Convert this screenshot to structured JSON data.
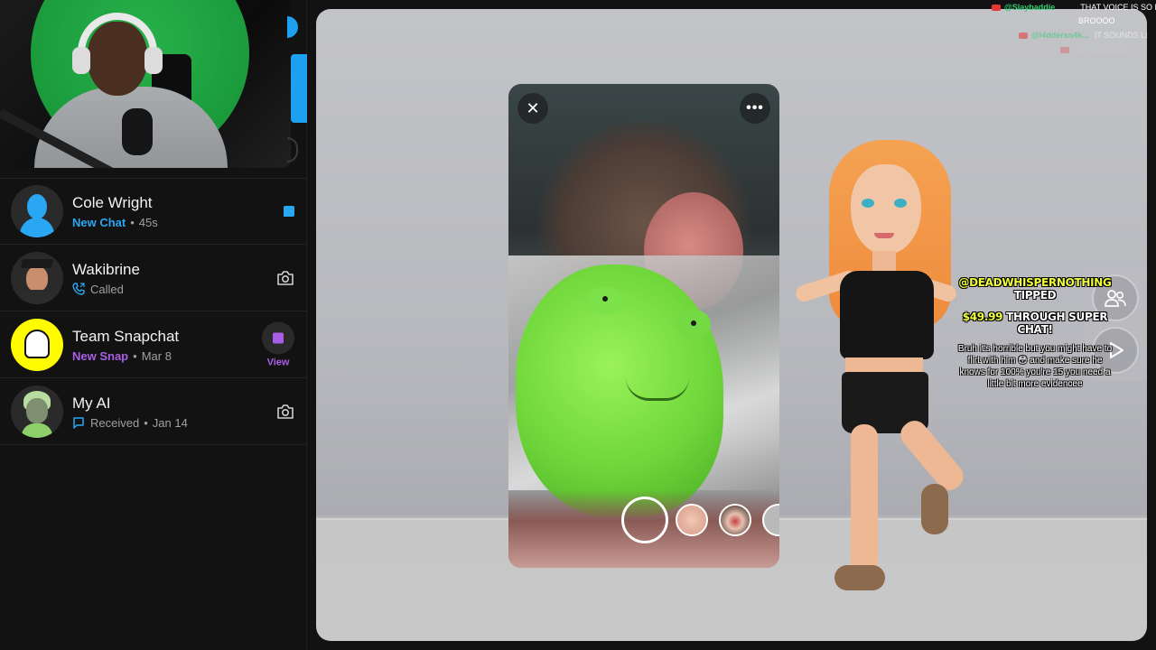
{
  "chats": [
    {
      "name": "Cole Wright",
      "status": "New Chat",
      "time": "45s",
      "status_color": "#2aa7f2",
      "status_icon": "",
      "action_icon": "chat-bubble-icon"
    },
    {
      "name": "Wakibrine",
      "status": "Called",
      "time": "",
      "status_color": "#a0a0a0",
      "status_icon": "phone-icon",
      "action_icon": "camera-icon"
    },
    {
      "name": "Team Snapchat",
      "status": "New Snap",
      "time": "Mar 8",
      "status_color": "#a85fe6",
      "status_icon": "",
      "action_icon": "snap-square-icon",
      "action_label": "View"
    },
    {
      "name": "My AI",
      "status": "Received",
      "time": "Jan 14",
      "status_color": "#a0a0a0",
      "status_icon": "chat-outline-icon",
      "action_icon": "camera-icon"
    }
  ],
  "story": {
    "close_glyph": "✕",
    "more_glyph": "•••"
  },
  "superchat": {
    "user": "@DEADWHISPERNOTHING",
    "tipped": "TIPPED",
    "amount": "$49.99",
    "through": "THROUGH SUPER CHAT!",
    "message": "Bruh it's horrible but you might have to flirt with him 😳 and make sure he knows for 100% you're 15 you need a little bit more evidencee"
  },
  "livechat": [
    {
      "user": "@Slaybaddie",
      "text": "THAT VOICE IS SO B"
    },
    {
      "user": "",
      "text": "BROOOO"
    },
    {
      "user": "@l4ddersn4k...",
      "text": "IT SOUNDS LI"
    },
    {
      "user": "@Theyluvvvb...",
      "text": ""
    }
  ],
  "colors": {
    "accent_blue": "#2aa7f2",
    "accent_purple": "#a85fe6",
    "snap_yellow": "#fffc00",
    "superchat_yellow": "#f1ff3b"
  }
}
